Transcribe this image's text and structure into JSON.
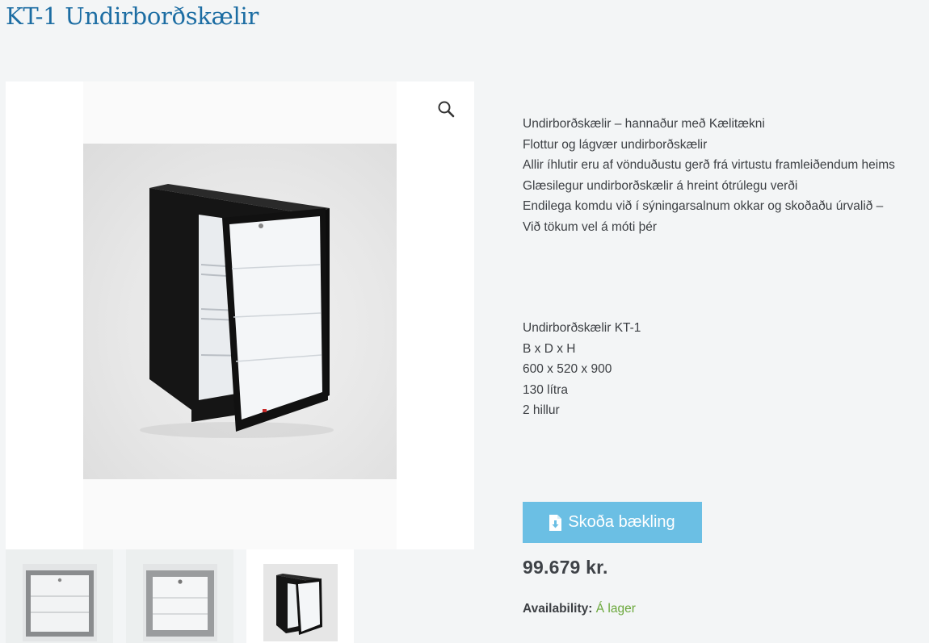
{
  "product": {
    "title": "KT-1 Undirborðskælir",
    "description_lines": [
      "Undirborðskælir – hannaður með Kælitækni",
      "Flottur og lágvær undirborðskælir",
      "Allir íhlutir eru af vönduðustu gerð frá virtustu framleiðendum heims",
      "Glæsilegur undirborðskælir á hreint ótrúlegu verði",
      "Endilega komdu við í sýningarsalnum okkar og skoðaðu úrvalið –",
      "Við tökum vel á móti þér"
    ],
    "spec_lines": [
      "Undirborðskælir KT-1",
      "B x D x H",
      "600 x 520 x 900",
      "130 lítra",
      "2 hillur"
    ],
    "brochure_label": "Skoða bækling",
    "price": "99.679 kr.",
    "availability_label": "Availability:",
    "availability_value": "Á lager"
  },
  "gallery": {
    "zoom_icon": "magnifier-icon",
    "thumbnails": [
      "fridge-front-grey",
      "fridge-front-grey-alt",
      "fridge-black-open-door"
    ],
    "active_thumbnail": 2
  },
  "colors": {
    "title": "#1c6da3",
    "button": "#6bbfe4",
    "in_stock": "#6ba83c",
    "background": "#f3f5f6"
  }
}
